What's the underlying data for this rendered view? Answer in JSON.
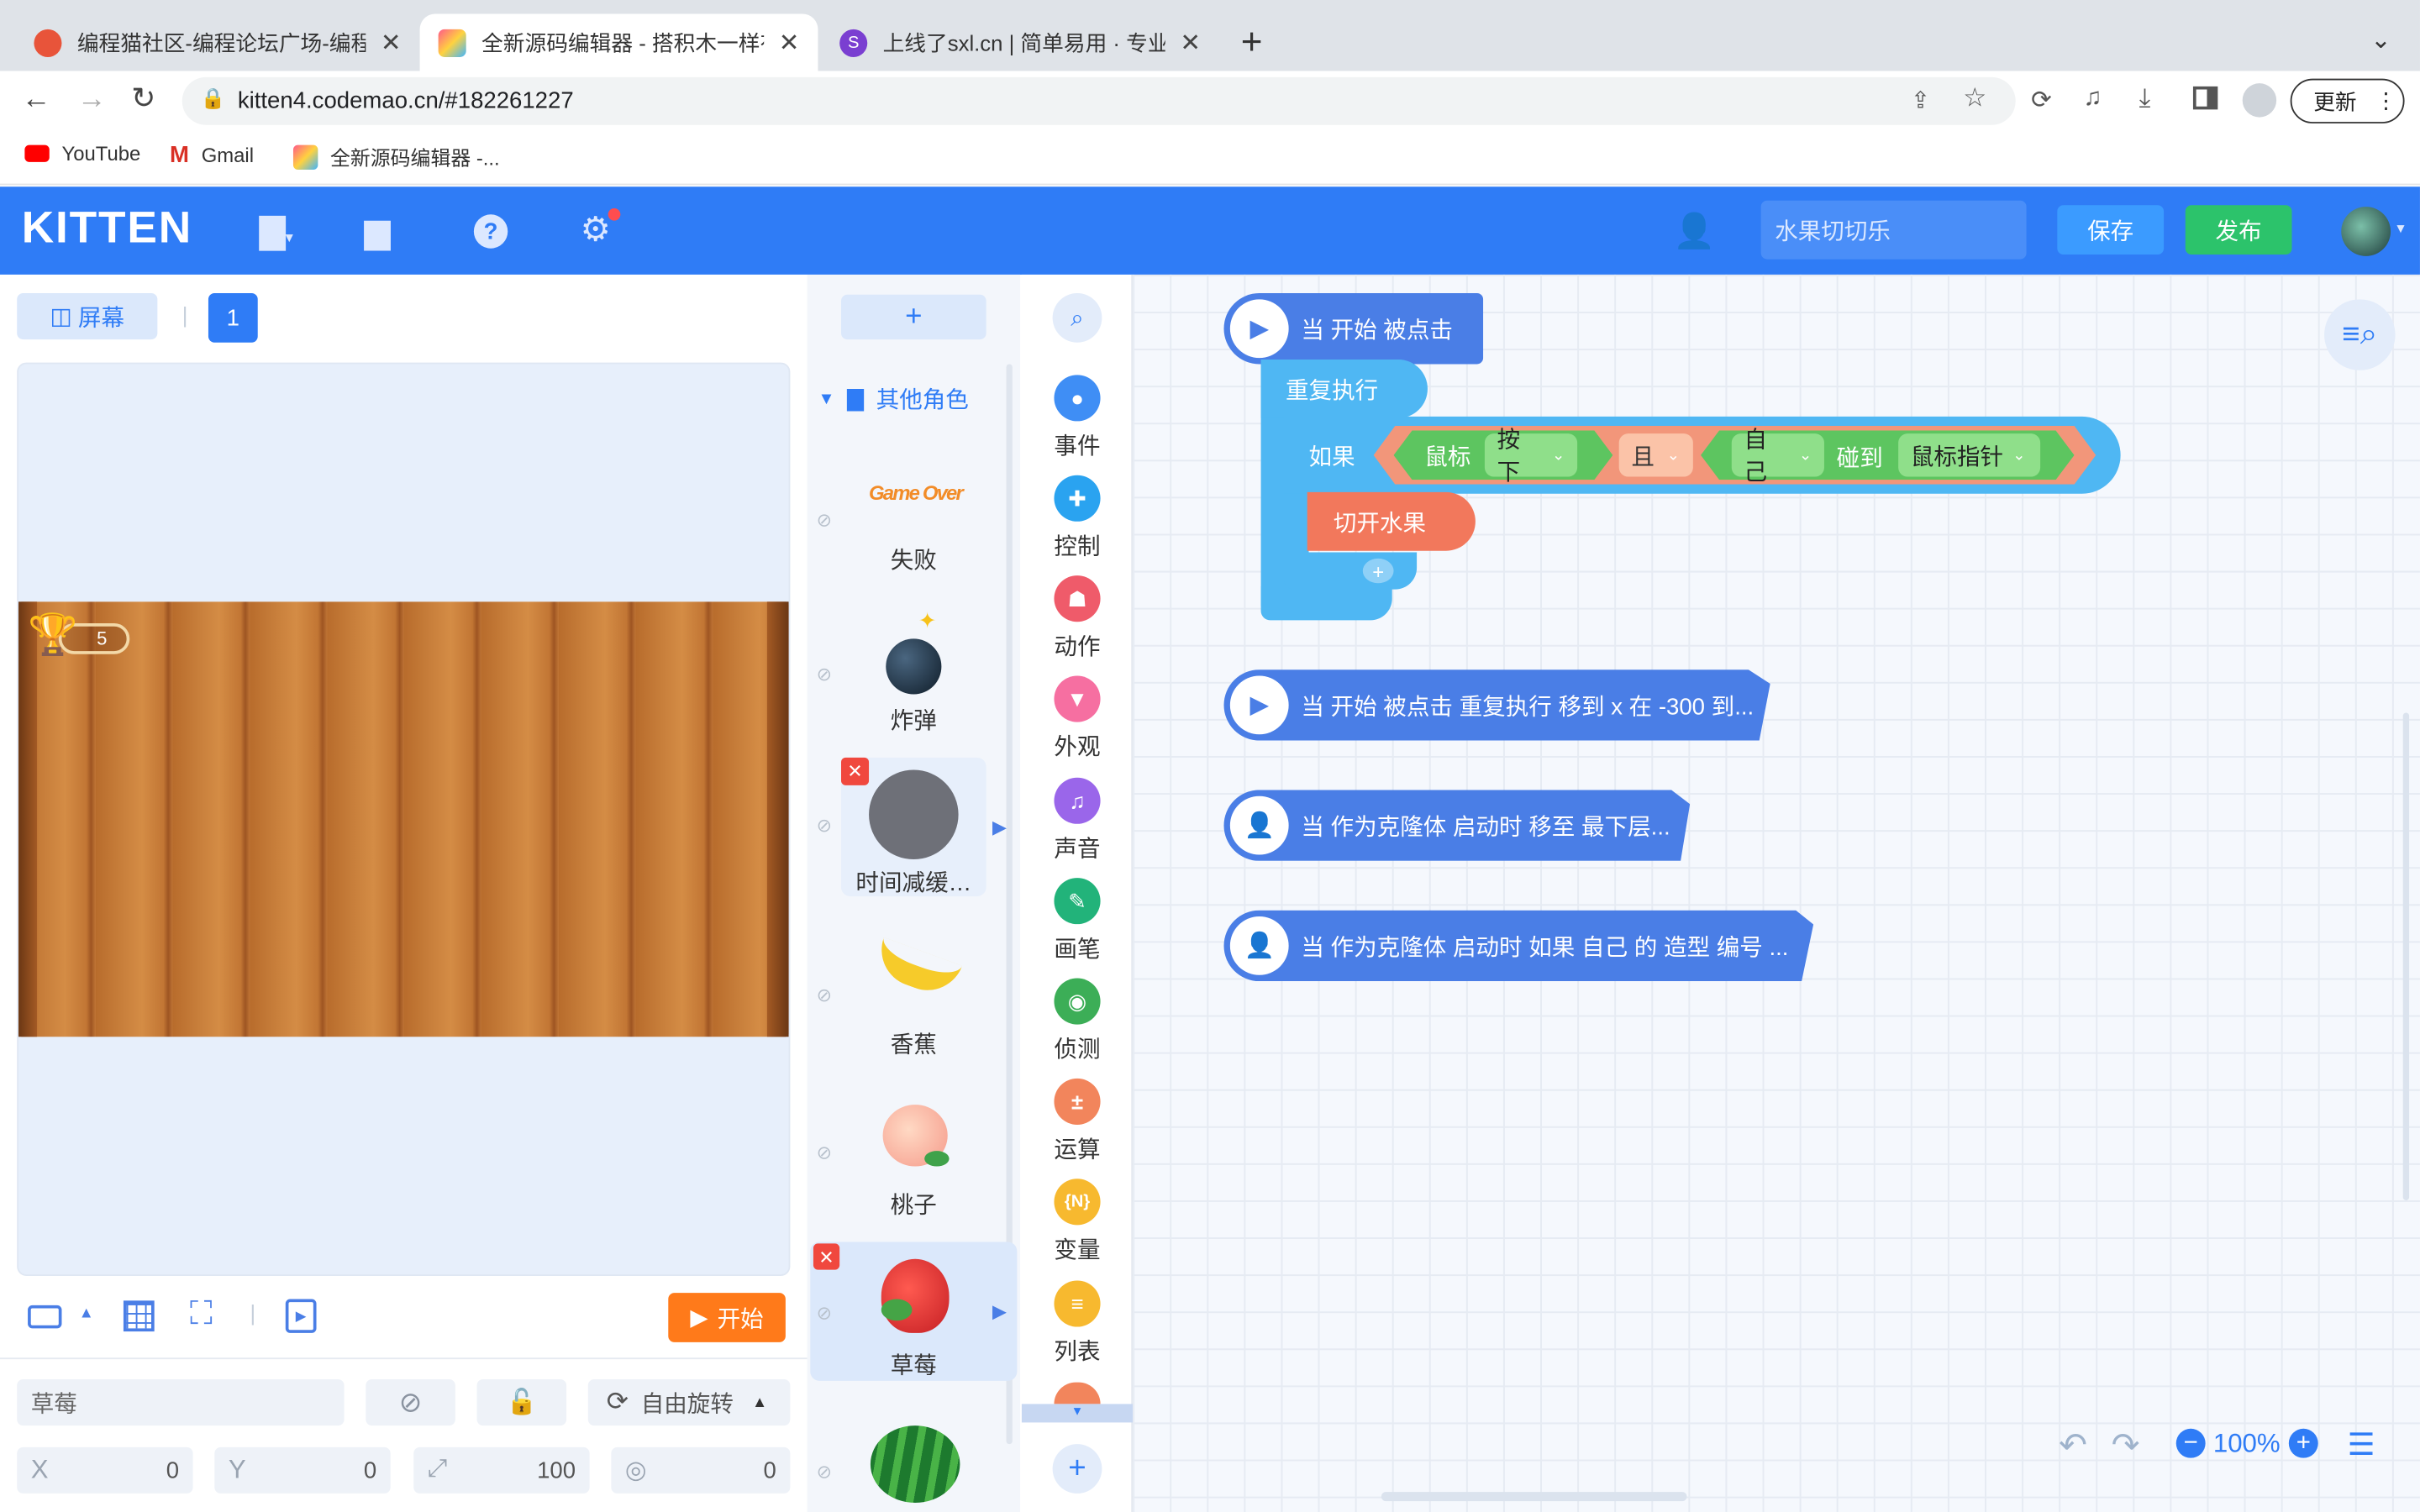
{
  "browser": {
    "tabs": [
      {
        "title": "编程猫社区-编程论坛广场-编程学",
        "active": false
      },
      {
        "title": "全新源码编辑器 - 搭积木一样有趣",
        "active": true
      },
      {
        "title": "上线了sxl.cn | 简单易用 · 专业美",
        "active": false
      }
    ],
    "new_tab": "+",
    "url": "kitten4.codemao.cn/#182261227",
    "update_label": "更新",
    "bookmarks": [
      "YouTube",
      "Gmail",
      "全新源码编辑器 -..."
    ]
  },
  "header": {
    "logo": "KITTEN",
    "project_name": "水果切切乐",
    "save_label": "保存",
    "publish_label": "发布",
    "accent": "#2f7cf6"
  },
  "stage": {
    "screen_label": "屏幕",
    "screen_number": "1",
    "score": "5",
    "start_label": "开始"
  },
  "props": {
    "name": "草莓",
    "rotation_mode": "自由旋转",
    "x_label": "X",
    "x_value": "0",
    "y_label": "Y",
    "y_value": "0",
    "scale_value": "100",
    "direction_value": "0"
  },
  "sprites": {
    "add": "+",
    "group": "其他角色",
    "items": [
      {
        "name": "失败",
        "badge": "Game Over"
      },
      {
        "name": "炸弹"
      },
      {
        "name": "时间减缓…"
      },
      {
        "name": "香蕉"
      },
      {
        "name": "桃子"
      },
      {
        "name": "草莓"
      }
    ]
  },
  "categories": [
    {
      "label": "事件",
      "color": "#3f8ef5",
      "icon": "toggle-icon"
    },
    {
      "label": "控制",
      "color": "#2aa3f0",
      "icon": "gamepad-icon"
    },
    {
      "label": "动作",
      "color": "#ef5b6a",
      "icon": "ghost-icon"
    },
    {
      "label": "外观",
      "color": "#f66fa1",
      "icon": "shirt-icon"
    },
    {
      "label": "声音",
      "color": "#9a66ea",
      "icon": "music-icon"
    },
    {
      "label": "画笔",
      "color": "#22b37a",
      "icon": "pen-icon"
    },
    {
      "label": "侦测",
      "color": "#3cae57",
      "icon": "sensor-icon"
    },
    {
      "label": "运算",
      "color": "#f2855c",
      "icon": "math-icon"
    },
    {
      "label": "变量",
      "color": "#f7b92f",
      "icon": "variable-icon"
    },
    {
      "label": "列表",
      "color": "#f7b92f",
      "icon": "list-icon"
    }
  ],
  "blocks": {
    "hat1": "当 开始 被点击",
    "repeat": "重复执行",
    "if": "如果",
    "mouse": "鼠标",
    "pressed": "按下",
    "and": "且",
    "self": "自己",
    "touch": "碰到",
    "pointer": "鼠标指针",
    "cut": "切开水果",
    "hat2": "当 开始 被点击 重复执行 移到 x 在 -300 到...",
    "hat3": "当 作为克隆体 启动时 移至 最下层...",
    "hat4": "当 作为克隆体 启动时 如果 自己 的 造型 编号 ..."
  },
  "zoom": "100%"
}
